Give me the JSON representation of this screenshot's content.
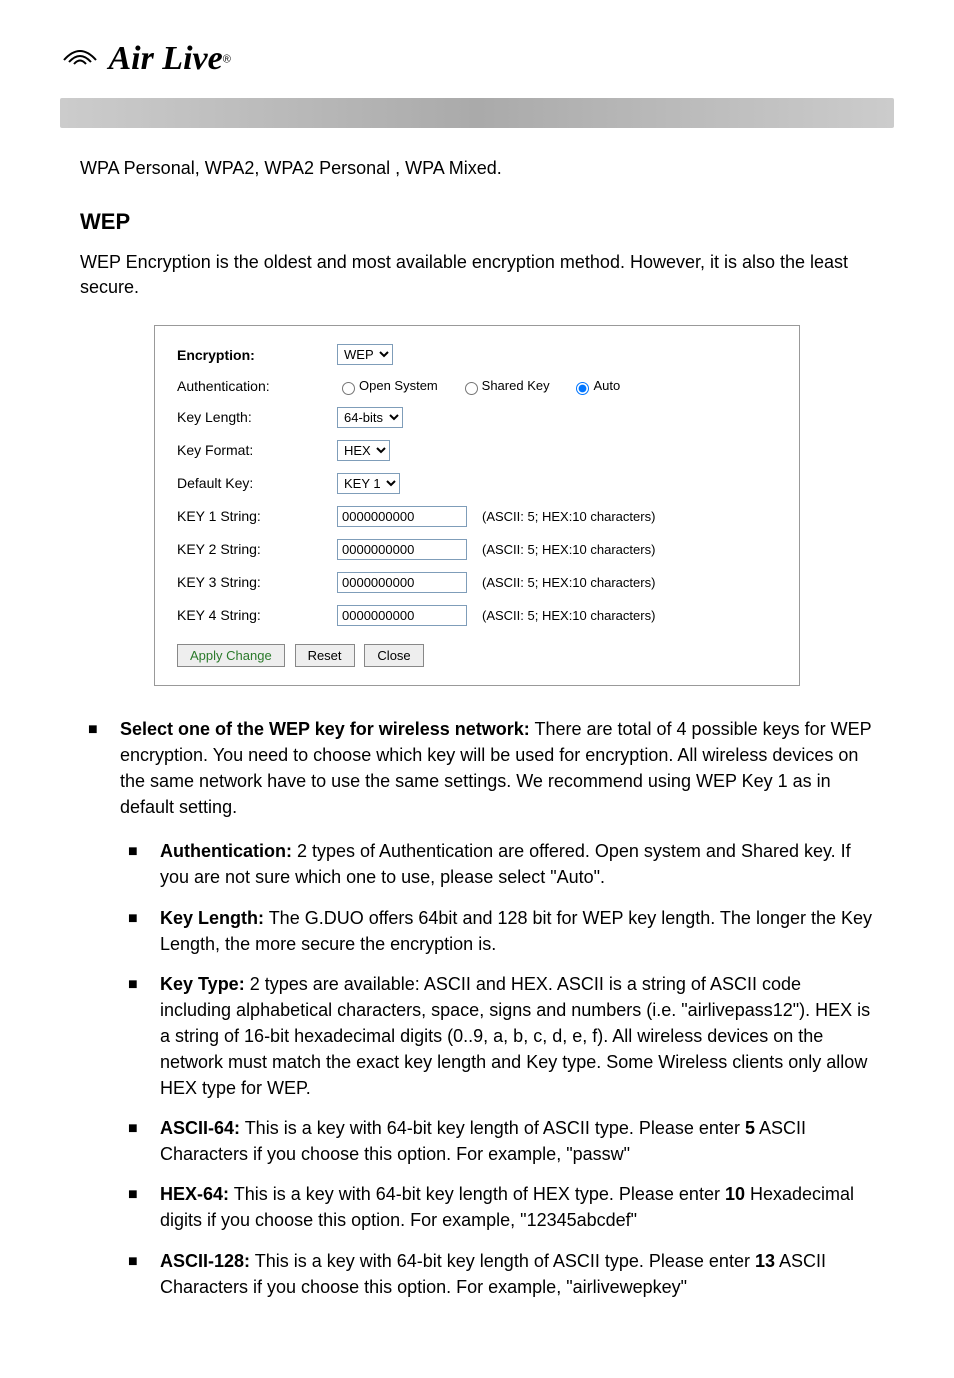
{
  "logo": {
    "brand": "Air Live",
    "reg": "®"
  },
  "intro": "WPA Personal, WPA2, WPA2 Personal , WPA Mixed.",
  "heading": "WEP",
  "wep_desc": "WEP Encryption is the oldest and most available encryption method.    However, it is also the least secure.",
  "config": {
    "encryption_label": "Encryption:",
    "encryption_value": "WEP",
    "auth_label": "Authentication:",
    "auth_open": "Open System",
    "auth_shared": "Shared Key",
    "auth_auto": "Auto",
    "keylen_label": "Key Length:",
    "keylen_value": "64-bits",
    "keyfmt_label": "Key Format:",
    "keyfmt_value": "HEX",
    "defkey_label": "Default Key:",
    "defkey_value": "KEY 1",
    "keys": [
      {
        "label": "KEY 1 String:",
        "value": "0000000000",
        "hint": "(ASCII: 5; HEX:10 characters)"
      },
      {
        "label": "KEY 2 String:",
        "value": "0000000000",
        "hint": "(ASCII: 5; HEX:10 characters)"
      },
      {
        "label": "KEY 3 String:",
        "value": "0000000000",
        "hint": "(ASCII: 5; HEX:10 characters)"
      },
      {
        "label": "KEY 4 String:",
        "value": "0000000000",
        "hint": "(ASCII: 5; HEX:10 characters)"
      }
    ],
    "apply": "Apply Change",
    "reset": "Reset",
    "close": "Close"
  },
  "bullets": {
    "main_bold": "Select one of the WEP key for wireless network:",
    "main_text": "   There are total of 4 possible keys for WEP encryption.    You need to choose which key will be used for encryption.    All wireless devices on the same network have to use the same settings.    We recommend using WEP Key 1 as in default setting.",
    "items": [
      {
        "bold": "Authentication:",
        "text": "   2 types of Authentication are offered.    Open system and Shared key.    If you are not sure which one to use, please select \"Auto\"."
      },
      {
        "bold": "Key Length:",
        "text": "   The G.DUO offers 64bit and 128 bit for WEP key length.    The longer the Key Length, the more secure the encryption is."
      },
      {
        "bold": "Key Type:",
        "text": "   2 types are available: ASCII and HEX.    ASCII is a string of ASCII code including alphabetical characters, space, signs and numbers (i.e. \"airlivepass12\").    HEX is a string of 16-bit hexadecimal digits (0..9, a, b, c, d, e, f).  All wireless devices on the network must match the exact key length and Key type.    Some Wireless clients only allow HEX type for WEP."
      },
      {
        "bold": "ASCII-64:",
        "text_a": " This is a key with 64-bit key length of ASCII type.    Please enter ",
        "bold2": "5",
        "text_b": " ASCII Characters if you choose this option. For example, \"passw\""
      },
      {
        "bold": "HEX-64:",
        "text_a": " This is a key with 64-bit key length of HEX type.    Please enter ",
        "bold2": "10",
        "text_b": " Hexadecimal digits if you choose this option. For example, \"12345abcdef\""
      },
      {
        "bold": "ASCII-128:",
        "text_a": " This is a key with 64-bit key length of ASCII type.    Please enter ",
        "bold2": "13",
        "text_b": " ASCII Characters if you choose this option. For example, \"airlivewepkey\""
      }
    ]
  }
}
